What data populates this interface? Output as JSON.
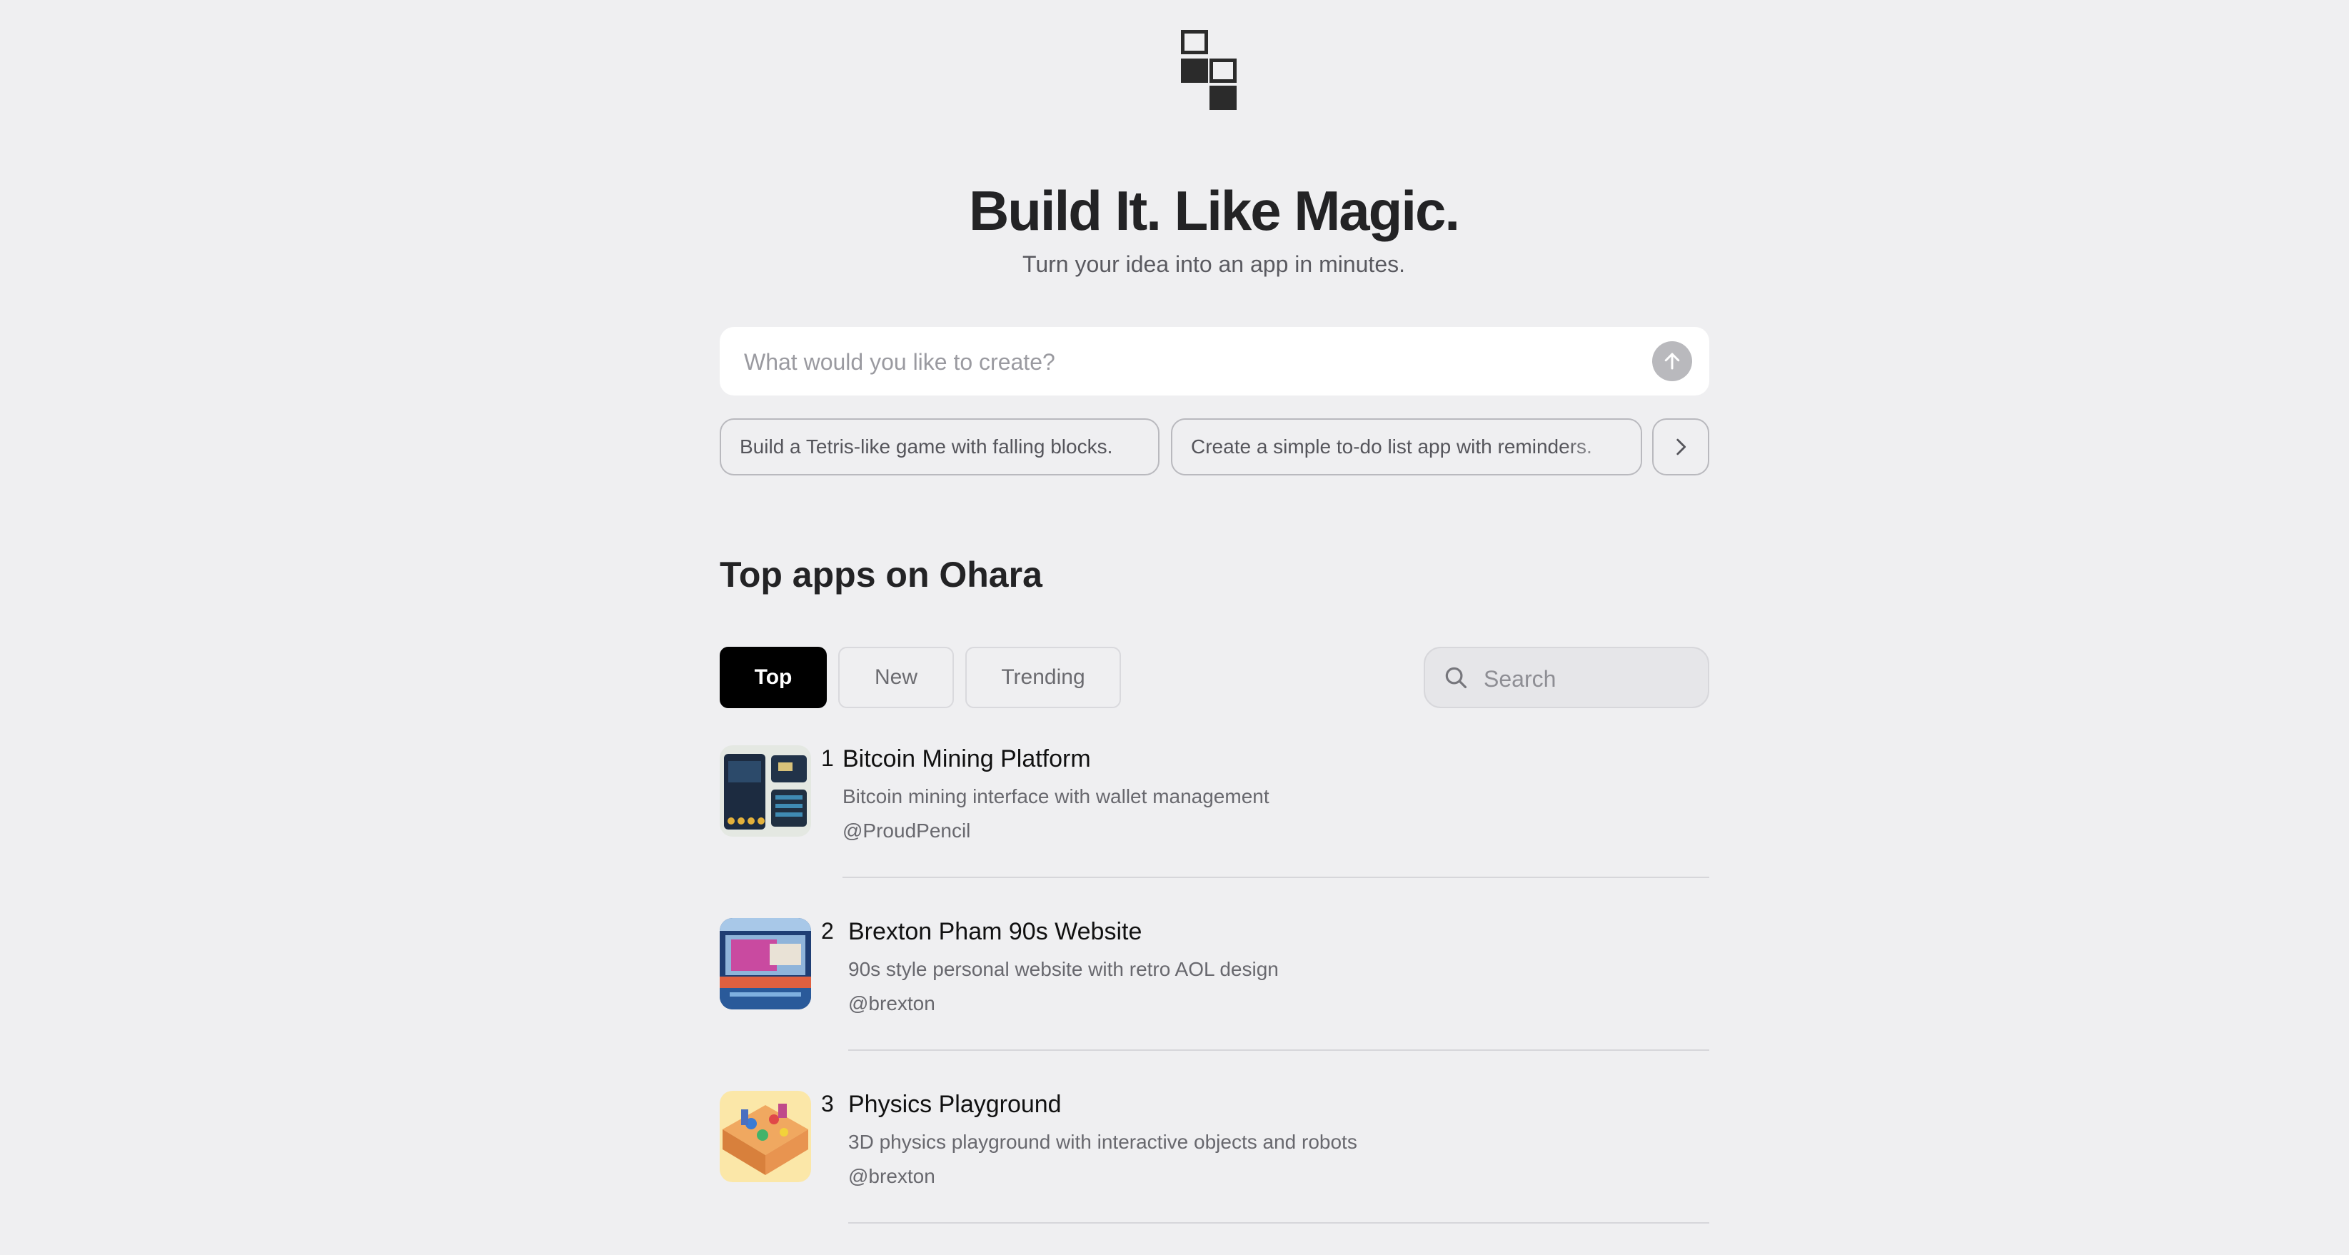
{
  "hero": {
    "title": "Build It. Like Magic.",
    "subtitle": "Turn your idea into an app in minutes."
  },
  "prompt": {
    "placeholder": "What would you like to create?",
    "send_icon": "arrow-up-icon"
  },
  "suggestions": [
    {
      "label": "Build a Tetris-like game with falling blocks."
    },
    {
      "label": "Create a simple to-do list app with reminders."
    }
  ],
  "suggestions_next_icon": "chevron-right-icon",
  "section": {
    "title": "Top apps on Ohara"
  },
  "tabs": [
    {
      "label": "Top",
      "active": true
    },
    {
      "label": "New",
      "active": false
    },
    {
      "label": "Trending",
      "active": false
    }
  ],
  "search": {
    "placeholder": "Search",
    "icon": "search-icon"
  },
  "apps": [
    {
      "rank": "1",
      "title": "Bitcoin Mining Platform",
      "description": "Bitcoin mining interface with wallet management",
      "author": "@ProudPencil"
    },
    {
      "rank": "2",
      "title": "Brexton Pham 90s Website",
      "description": "90s style personal website with retro AOL design",
      "author": "@brexton"
    },
    {
      "rank": "3",
      "title": "Physics Playground",
      "description": "3D physics playground with interactive objects and robots",
      "author": "@brexton"
    }
  ],
  "colors": {
    "background": "#efeff1",
    "active_tab": "#000000",
    "send_button": "#b9b9bd",
    "text_primary": "#232325",
    "text_secondary": "#68686e"
  }
}
